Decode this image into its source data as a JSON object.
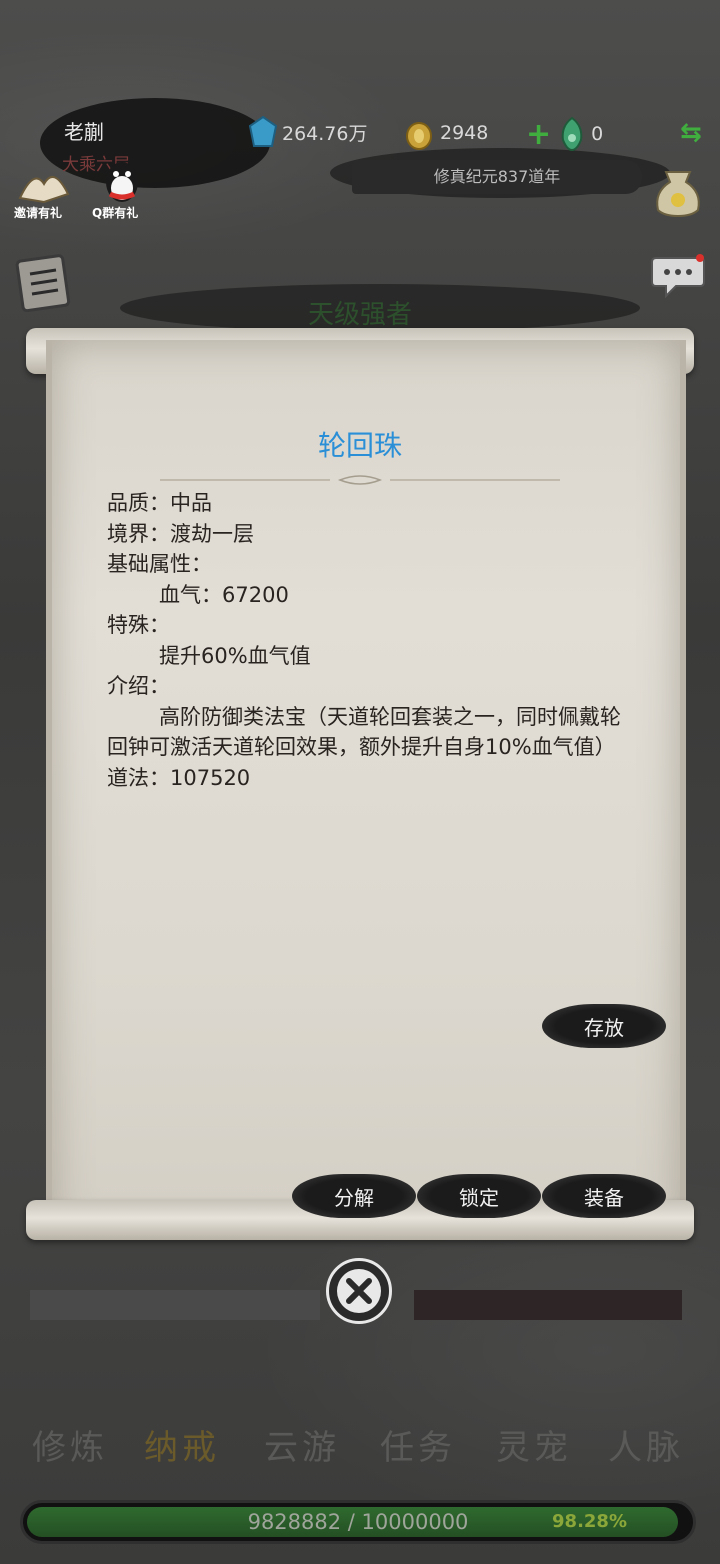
{
  "player": {
    "name": "老蒯",
    "realm": "大乘六层"
  },
  "resources": {
    "spirit_stones": "264.76万",
    "gold": "2948",
    "jade": "0"
  },
  "era": "修真纪元837道年",
  "shortcuts": {
    "invite": "邀请有礼",
    "qq": "Q群有礼"
  },
  "banner": "天级强者",
  "item": {
    "name": "轮回珠",
    "quality": "品质：中品",
    "level": "境界：渡劫一层",
    "base_attr_label": "基础属性：",
    "base_attr": "血气：67200",
    "special_label": "特殊：",
    "special": "提升60%血气值",
    "intro_label": "介绍：",
    "intro": "高阶防御类法宝（天道轮回套装之一，同时佩戴轮回钟可激活天道轮回效果，额外提升自身10%血气值）",
    "daofa": "道法：107520"
  },
  "actions": {
    "store": "存放",
    "decompose": "分解",
    "lock": "锁定",
    "equip": "装备"
  },
  "tabs": [
    "修炼",
    "纳戒",
    "云游",
    "任务",
    "灵宠",
    "人脉"
  ],
  "progress": {
    "text": "9828882 / 10000000",
    "percent_label": "98.28%",
    "fraction": 0.9828
  },
  "colors": {
    "title": "#2a8fd6",
    "active_tab": "#6b5a2a",
    "progress": "#2f6a2f"
  }
}
